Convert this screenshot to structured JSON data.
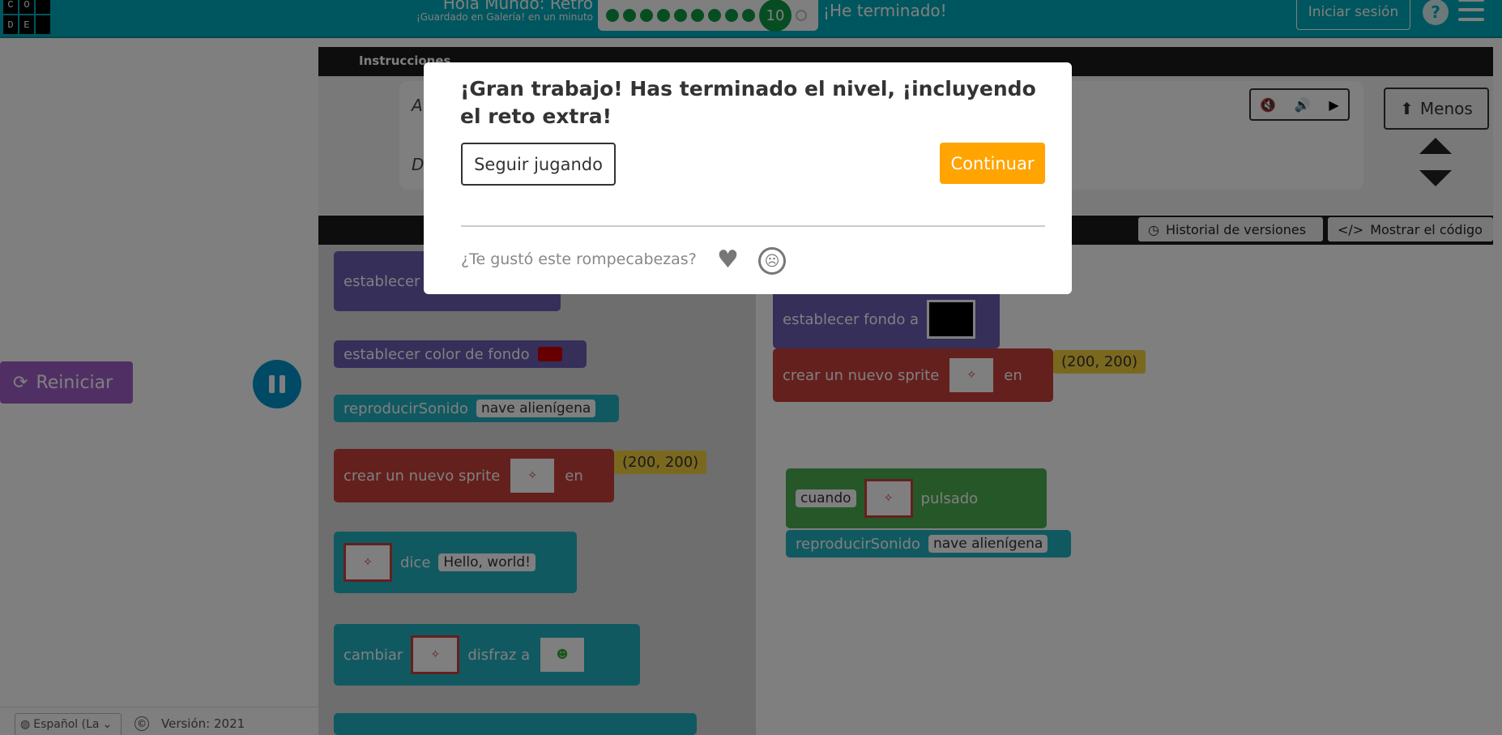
{
  "header": {
    "logo_letters": [
      "C",
      "O",
      "D",
      "E"
    ],
    "title": "Hola Mundo: Retro",
    "subtitle": "¡Guardado en Galería! en un minuto",
    "progress_level": "10",
    "progress_dots_completed": 9,
    "finished_label": "¡He terminado!",
    "login_label": "Iniciar sesión",
    "help_icon": "?",
    "menu_icon": "hamburger-icon"
  },
  "left_panel": {
    "reset_label": "Reiniciar",
    "reset_icon": "refresh-icon",
    "pause_icon": "pause-icon"
  },
  "footer": {
    "language": "Español (La",
    "copyright_icon": "©",
    "version": "Versión: 2021"
  },
  "instructions": {
    "tab_label": "Instrucciones",
    "line1": "A",
    "line2": "D",
    "less_label": "Menos"
  },
  "workspace_bar": {
    "history_label": "Historial de versiones",
    "show_code_label": "Mostrar el código"
  },
  "toolbox": {
    "block_background": "establecer",
    "block_bgcolor": "establecer color de fondo",
    "block_play_sound": "reproducirSonido",
    "sound_option": "nave alienígena",
    "block_new_sprite": "crear un nuevo sprite",
    "in_label": "en",
    "coords": "(200, 200)",
    "says_label": "dice",
    "hello": "Hello, world!",
    "change_label": "cambiar",
    "costume_label": "disfraz a"
  },
  "workspace": {
    "set_background": "establecer fondo a",
    "new_sprite": "crear un nuevo sprite",
    "in_label": "en",
    "coords": "(200, 200)",
    "when_option": "cuando",
    "pressed_label": "pulsado",
    "play_sound": "reproducirSonido",
    "sound_option": "nave alienígena"
  },
  "modal": {
    "title": "¡Gran trabajo! Has terminado el nivel, ¡incluyendo el reto extra!",
    "keep_playing": "Seguir jugando",
    "continue": "Continuar",
    "feedback_question": "¿Te gustó este rompecabezas?",
    "heart_icon": "♥",
    "sad_icon": "☹"
  },
  "colors": {
    "header": "#00adbc",
    "continue": "#ffa400",
    "progress": "#0f9b47"
  }
}
